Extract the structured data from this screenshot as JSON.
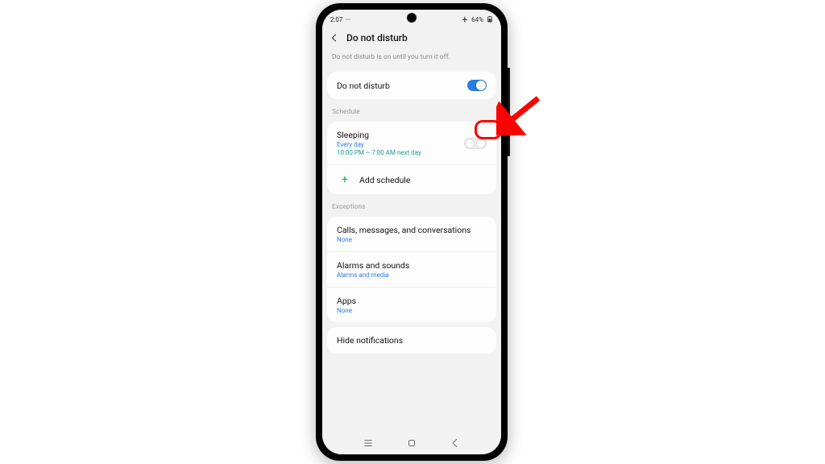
{
  "status": {
    "time": "2:07",
    "battery_pct": "64%"
  },
  "header": {
    "title": "Do not disturb",
    "subtitle": "Do not disturb is on until you turn it off."
  },
  "main_toggle": {
    "label": "Do not disturb",
    "on": true
  },
  "schedule": {
    "section_label": "Schedule",
    "items": [
      {
        "title": "Sleeping",
        "recurrence": "Every day",
        "time_range": "10:00 PM ~ 7:00 AM next day",
        "on": false
      }
    ],
    "add_label": "Add schedule"
  },
  "exceptions": {
    "section_label": "Exceptions",
    "items": [
      {
        "title": "Calls, messages, and conversations",
        "value": "None"
      },
      {
        "title": "Alarms and sounds",
        "value": "Alarms and media"
      },
      {
        "title": "Apps",
        "value": "None"
      }
    ]
  },
  "hide": {
    "label": "Hide notifications"
  },
  "colors": {
    "accent": "#2a7de1",
    "callout": "#ff0000"
  }
}
